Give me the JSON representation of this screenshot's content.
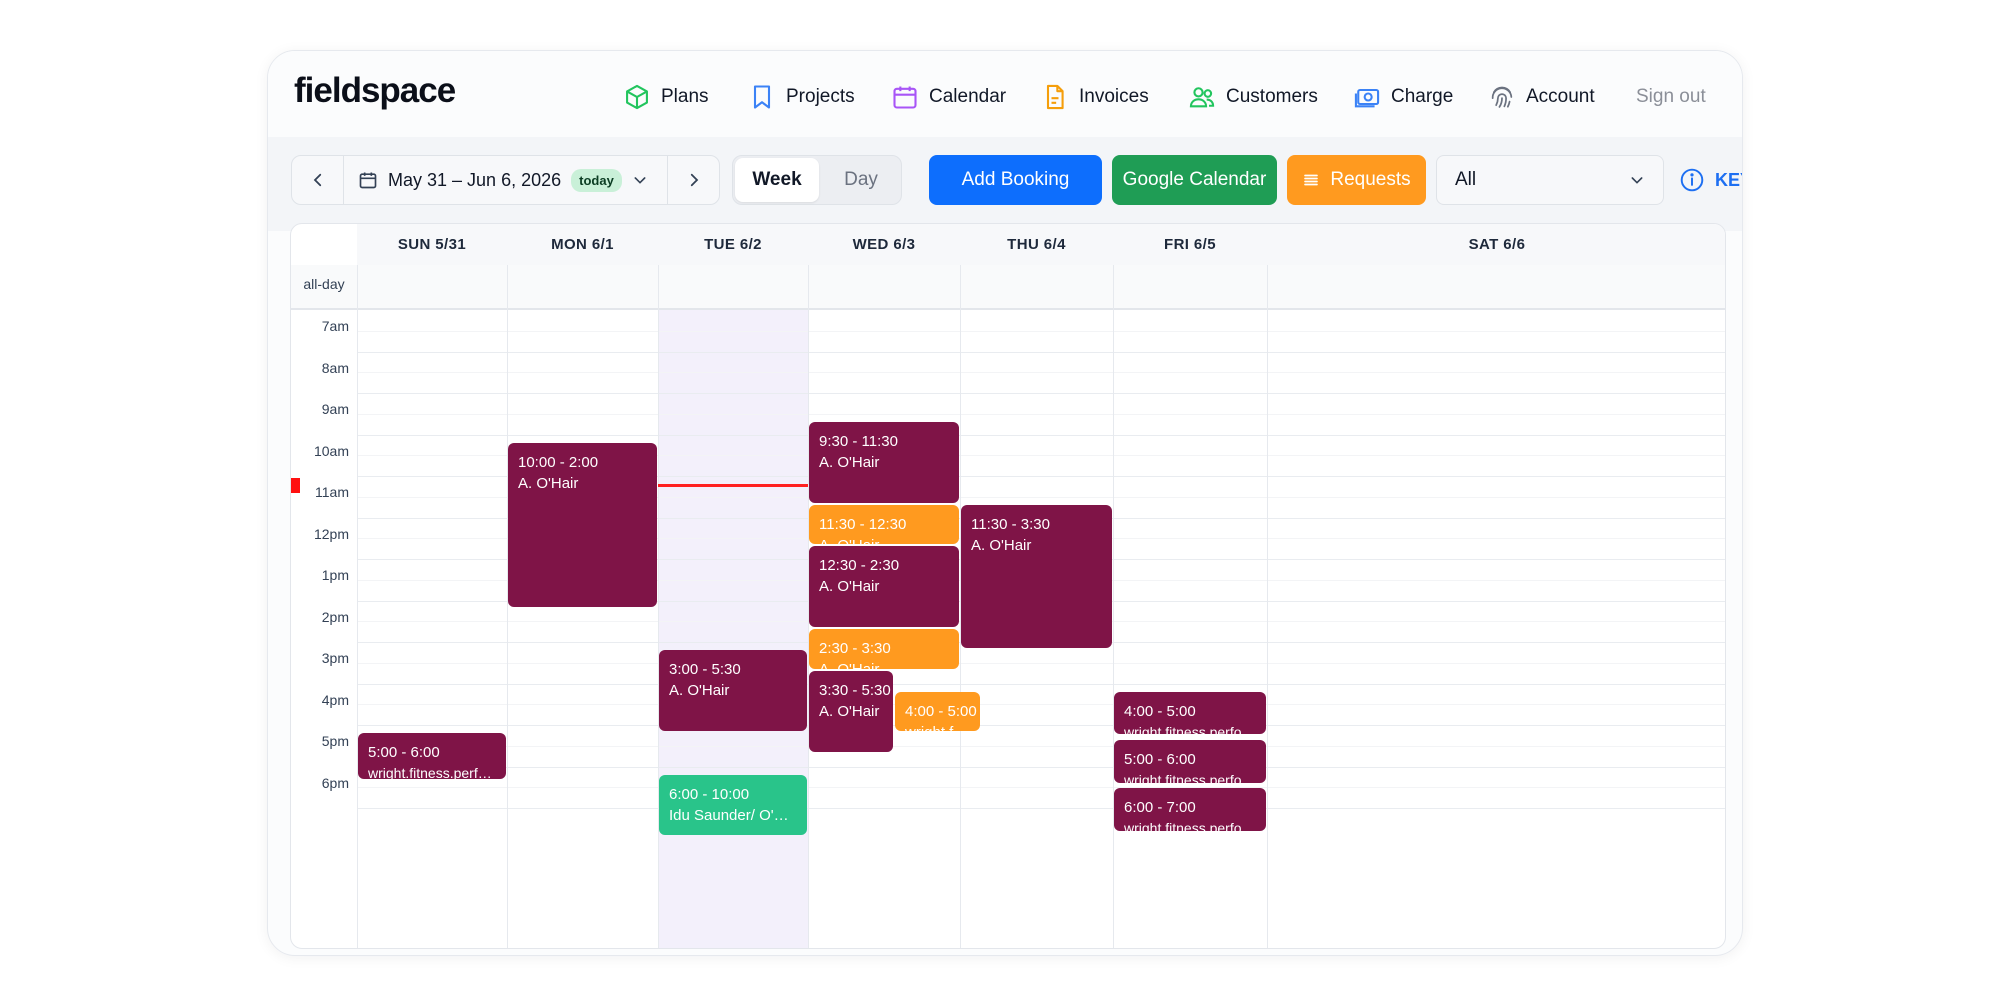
{
  "app": {
    "name": "fieldspace"
  },
  "colors": {
    "event_default": "#7f1447",
    "event_orange": "#ff9a1f",
    "event_green": "#29c48a",
    "primary": "#0d6efd",
    "now_line": "#ff2020"
  },
  "nav": [
    {
      "label": "Plans",
      "icon": "cube-icon",
      "color": "#22c55e"
    },
    {
      "label": "Projects",
      "icon": "bookmark-icon",
      "color": "#3b82f6"
    },
    {
      "label": "Calendar",
      "icon": "calendar-icon",
      "color": "#a855f7"
    },
    {
      "label": "Invoices",
      "icon": "document-icon",
      "color": "#f59e0b"
    },
    {
      "label": "Customers",
      "icon": "users-icon",
      "color": "#22c55e"
    },
    {
      "label": "Charge",
      "icon": "money-icon",
      "color": "#3b82f6"
    },
    {
      "label": "Account",
      "icon": "fingerprint-icon",
      "color": "#6b7280"
    }
  ],
  "signout": "Sign out",
  "toolbar": {
    "range": "May 31 – Jun 6, 2026",
    "today_badge": "today",
    "view_week": "Week",
    "view_day": "Day",
    "add_booking": "Add Booking",
    "google_calendar": "Google Calendar",
    "requests": "Requests",
    "filter_value": "All",
    "key": "KEY"
  },
  "calendar": {
    "all_day_label": "all-day",
    "days": [
      "SUN 5/31",
      "MON 6/1",
      "TUE 6/2",
      "WED 6/3",
      "THU 6/4",
      "FRI 6/5",
      "SAT 6/6"
    ],
    "today_index": 2,
    "hours": [
      "7am",
      "8am",
      "9am",
      "10am",
      "11am",
      "12pm",
      "1pm",
      "2pm",
      "3pm",
      "4pm",
      "5pm",
      "6pm"
    ],
    "now_time": "11:00",
    "events": [
      {
        "day": 1,
        "start": "10:00",
        "end": "14:00",
        "time": "10:00 - 2:00",
        "person": "A. O'Hair",
        "color": "#7f1447"
      },
      {
        "day": 3,
        "start": "09:30",
        "end": "11:30",
        "time": "9:30 - 11:30",
        "person": "A. O'Hair",
        "color": "#7f1447"
      },
      {
        "day": 3,
        "start": "11:30",
        "end": "12:30",
        "time": "11:30 - 12:30",
        "person": "A. O'Hair",
        "color": "#ff9a1f"
      },
      {
        "day": 3,
        "start": "12:30",
        "end": "14:30",
        "time": "12:30 - 2:30",
        "person": "A. O'Hair",
        "color": "#7f1447"
      },
      {
        "day": 3,
        "start": "14:30",
        "end": "15:30",
        "time": "2:30 - 3:30",
        "person": "A. O'Hair",
        "color": "#ff9a1f"
      },
      {
        "day": 3,
        "start": "15:30",
        "end": "17:30",
        "time": "3:30 - 5:30",
        "person": "A. O'Hair",
        "color": "#7f1447",
        "split": "left"
      },
      {
        "day": 3,
        "start": "16:00",
        "end": "17:00",
        "time": "4:00 - 5:00",
        "person": "wright.fitn...",
        "color": "#ff9a1f",
        "split": "right"
      },
      {
        "day": 4,
        "start": "11:30",
        "end": "15:00",
        "time": "11:30 - 3:30",
        "person": "A. O'Hair",
        "color": "#7f1447"
      },
      {
        "day": 2,
        "start": "15:00",
        "end": "17:00",
        "time": "3:00 - 5:30",
        "person": "A. O'Hair",
        "color": "#7f1447"
      },
      {
        "day": 2,
        "start": "18:00",
        "end": "19:30",
        "time": "6:00 - 10:00",
        "person": "Idu Saunder/ O'Hair",
        "color": "#29c48a"
      },
      {
        "day": 0,
        "start": "17:00",
        "end": "18:10",
        "time": "5:00 - 6:00",
        "person": "wright.fitness.performance",
        "color": "#7f1447"
      },
      {
        "day": 5,
        "start": "16:00",
        "end": "17:05",
        "time": "4:00 - 5:00",
        "person": "wright.fitness.performance",
        "color": "#7f1447"
      },
      {
        "day": 5,
        "start": "17:10",
        "end": "18:15",
        "time": "5:00 - 6:00",
        "person": "wright.fitness.performance",
        "color": "#7f1447"
      },
      {
        "day": 5,
        "start": "18:20",
        "end": "19:25",
        "time": "6:00 - 7:00",
        "person": "wright.fitness.performance",
        "color": "#7f1447"
      }
    ]
  }
}
